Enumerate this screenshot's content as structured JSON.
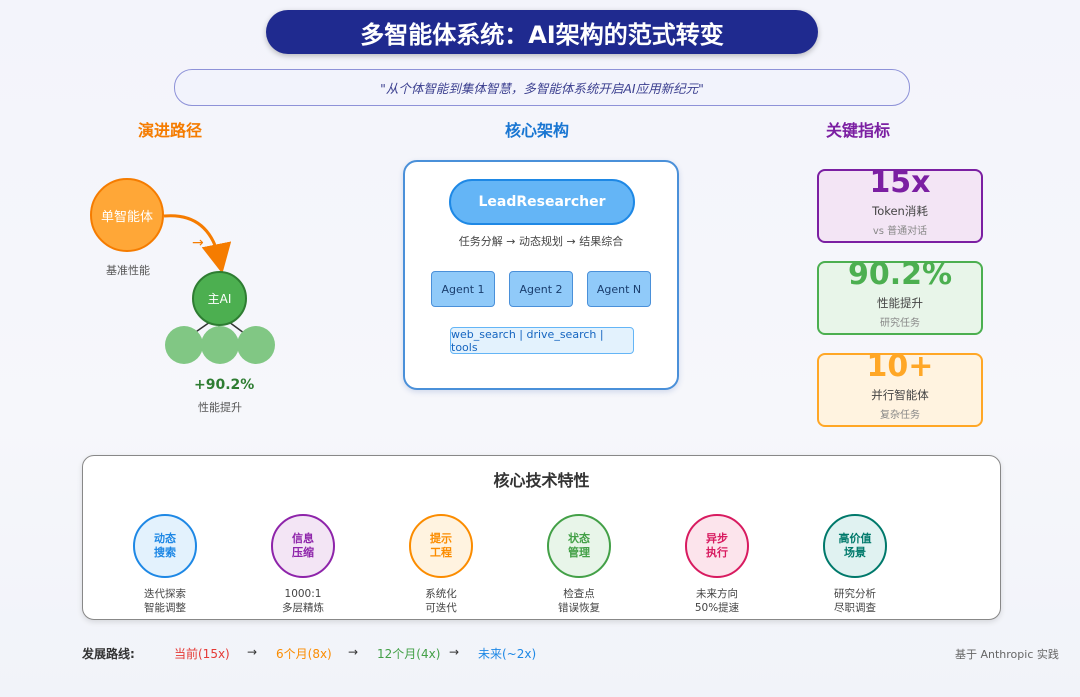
{
  "title": "多智能体系统：AI架构的范式转变",
  "quote": "\"从个体智能到集体智慧，多智能体系统开启AI应用新纪元\"",
  "sections": {
    "evolution": "演进路径",
    "architecture": "核心架构",
    "metrics": "关键指标"
  },
  "evolution": {
    "single_label": "单智能体",
    "single_caption": "基准性能",
    "main_label": "主AI",
    "gain": "+90.2%",
    "gain_caption": "性能提升"
  },
  "architecture": {
    "lead": "LeadResearcher",
    "flow": "任务分解 → 动态规划 → 结果综合",
    "agents": [
      "Agent 1",
      "Agent 2",
      "Agent N"
    ],
    "tools": "web_search | drive_search | tools"
  },
  "metrics": [
    {
      "value": "15x",
      "label": "Token消耗",
      "sub": "vs 普通对话",
      "color": "#7b1fa2",
      "bg": "#f3e5f5"
    },
    {
      "value": "90.2%",
      "label": "性能提升",
      "sub": "研究任务",
      "color": "#4caf50",
      "bg": "#e8f5e9"
    },
    {
      "value": "10+",
      "label": "并行智能体",
      "sub": "复杂任务",
      "color": "#ffa726",
      "bg": "#fff3e0"
    }
  ],
  "features": {
    "title": "核心技术特性",
    "items": [
      {
        "name1": "动态",
        "name2": "搜索",
        "d1": "迭代探索",
        "d2": "智能调整",
        "color": "#1e88e5",
        "bg": "#e3f2fd"
      },
      {
        "name1": "信息",
        "name2": "压缩",
        "d1": "1000:1",
        "d2": "多层精炼",
        "color": "#8e24aa",
        "bg": "#f3e5f5"
      },
      {
        "name1": "提示",
        "name2": "工程",
        "d1": "系统化",
        "d2": "可迭代",
        "color": "#fb8c00",
        "bg": "#fff3e0"
      },
      {
        "name1": "状态",
        "name2": "管理",
        "d1": "检查点",
        "d2": "错误恢复",
        "color": "#43a047",
        "bg": "#e8f5e9"
      },
      {
        "name1": "异步",
        "name2": "执行",
        "d1": "未来方向",
        "d2": "50%提速",
        "color": "#d81b60",
        "bg": "#fce4ec"
      },
      {
        "name1": "高价值",
        "name2": "场景",
        "d1": "研究分析",
        "d2": "尽职调查",
        "color": "#00796b",
        "bg": "#e0f2f1"
      }
    ]
  },
  "roadmap": {
    "label": "发展路线:",
    "stages": [
      {
        "text": "当前(15x)",
        "color": "#e53935"
      },
      {
        "text": "6个月(8x)",
        "color": "#fb8c00"
      },
      {
        "text": "12个月(4x)",
        "color": "#43a047"
      },
      {
        "text": "未来(~2x)",
        "color": "#1e88e5"
      }
    ],
    "arrow": "→"
  },
  "source": "基于 Anthropic 实践"
}
